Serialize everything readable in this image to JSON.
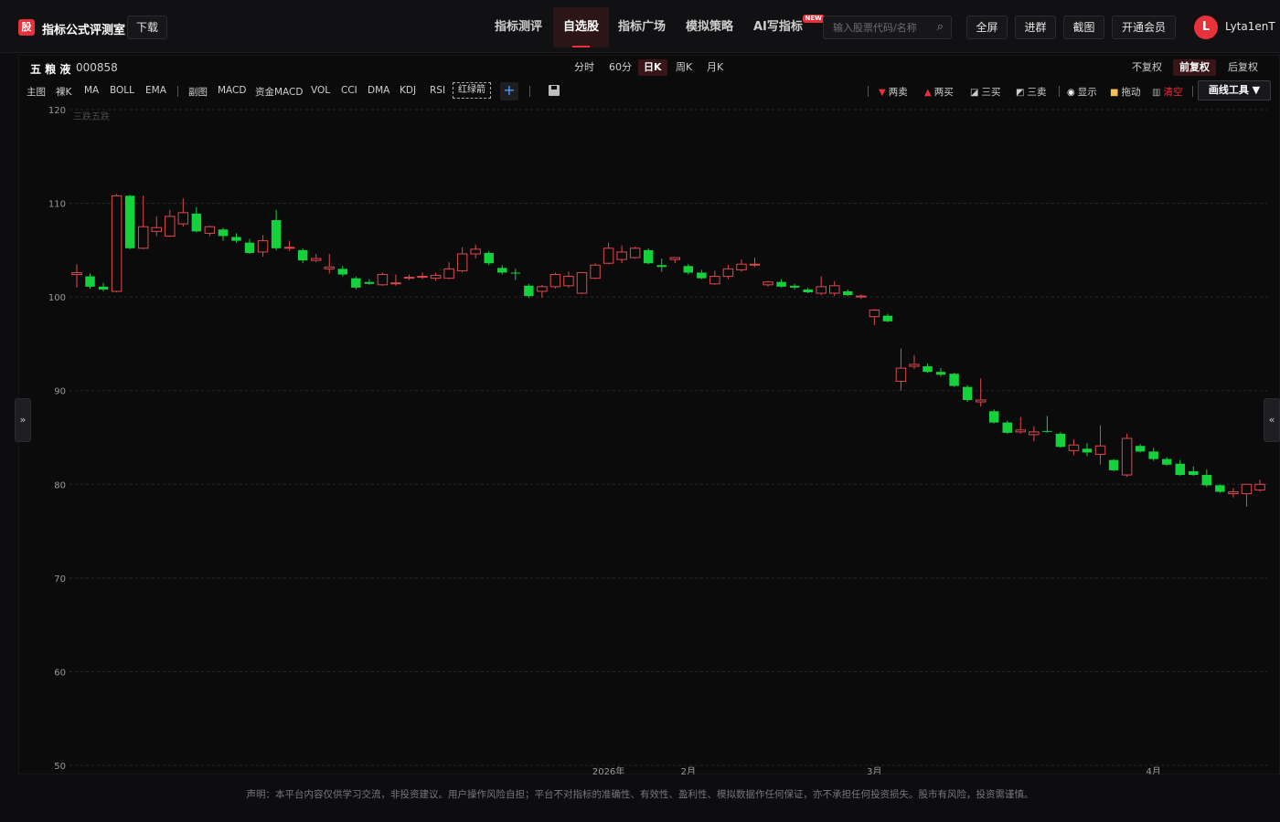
{
  "header": {
    "logo_char": "股",
    "app_title": "指标公式评测室",
    "download": "下载",
    "nav": [
      "指标测评",
      "自选股",
      "指标广场",
      "模拟策略",
      "AI写指标"
    ],
    "nav_active_index": 1,
    "new_badge": "NEW",
    "search_placeholder": "输入股票代码/名称",
    "fullscreen": "全屏",
    "join_group": "进群",
    "screenshot": "截图",
    "vip": "开通会员",
    "avatar_letter": "L",
    "username": "Lyta1enT"
  },
  "stock": {
    "name": "五 粮 液",
    "code": "000858"
  },
  "periods": [
    "分时",
    "60分",
    "日K",
    "周K",
    "月K"
  ],
  "period_active_index": 2,
  "adjust": [
    "不复权",
    "前复权",
    "后复权"
  ],
  "adjust_active_index": 1,
  "main_indicators": [
    "主图",
    "裸K",
    "MA",
    "BOLL",
    "EMA"
  ],
  "sub_indicators": [
    "副图",
    "MACD",
    "资金MACD",
    "VOL",
    "CCI",
    "DMA",
    "KDJ",
    "RSI"
  ],
  "red_green_arrow": "红绿箭",
  "draw_tools": {
    "two_sell": "两卖",
    "two_buy": "两买",
    "three_buy": "三买",
    "three_sell": "三卖",
    "show": "显示",
    "drag": "拖动",
    "clear": "清空",
    "tools_menu": "画线工具 ▼"
  },
  "side_left": "»",
  "side_right": "«",
  "chart_data": {
    "type": "candlestick",
    "annotation": "三跌五跌",
    "ylim": [
      50,
      120
    ],
    "yticks": [
      50,
      60,
      70,
      80,
      90,
      100,
      110,
      120
    ],
    "x_labels": [
      {
        "label": "2026年",
        "index": 40
      },
      {
        "label": "2月",
        "index": 46
      },
      {
        "label": "3月",
        "index": 60
      },
      {
        "label": "4月",
        "index": 81
      }
    ],
    "up_color": "#e0484c",
    "down_color": "#14d13c",
    "candles": [
      {
        "o": 102.4,
        "h": 103.5,
        "l": 101.0,
        "c": 102.6
      },
      {
        "o": 102.2,
        "h": 102.5,
        "l": 100.9,
        "c": 101.1
      },
      {
        "o": 101.1,
        "h": 101.5,
        "l": 100.6,
        "c": 100.8
      },
      {
        "o": 100.6,
        "h": 111.0,
        "l": 100.5,
        "c": 110.8
      },
      {
        "o": 110.8,
        "h": 110.9,
        "l": 105.1,
        "c": 105.2
      },
      {
        "o": 105.2,
        "h": 110.8,
        "l": 105.1,
        "c": 107.5
      },
      {
        "o": 107.0,
        "h": 108.6,
        "l": 106.5,
        "c": 107.4
      },
      {
        "o": 106.5,
        "h": 109.3,
        "l": 106.4,
        "c": 108.6
      },
      {
        "o": 107.8,
        "h": 110.5,
        "l": 107.5,
        "c": 109.0
      },
      {
        "o": 108.9,
        "h": 109.6,
        "l": 106.9,
        "c": 107.0
      },
      {
        "o": 106.8,
        "h": 107.6,
        "l": 106.5,
        "c": 107.5
      },
      {
        "o": 107.2,
        "h": 107.4,
        "l": 106.0,
        "c": 106.5
      },
      {
        "o": 106.4,
        "h": 106.8,
        "l": 105.8,
        "c": 106.0
      },
      {
        "o": 105.8,
        "h": 106.2,
        "l": 104.6,
        "c": 104.7
      },
      {
        "o": 104.8,
        "h": 106.6,
        "l": 104.3,
        "c": 106.0
      },
      {
        "o": 108.2,
        "h": 109.3,
        "l": 105.0,
        "c": 105.2
      },
      {
        "o": 105.2,
        "h": 106.0,
        "l": 104.9,
        "c": 105.3
      },
      {
        "o": 105.0,
        "h": 105.2,
        "l": 103.6,
        "c": 103.9
      },
      {
        "o": 103.9,
        "h": 104.6,
        "l": 103.7,
        "c": 104.1
      },
      {
        "o": 103.0,
        "h": 104.6,
        "l": 102.5,
        "c": 103.2
      },
      {
        "o": 103.0,
        "h": 103.3,
        "l": 102.2,
        "c": 102.4
      },
      {
        "o": 102.0,
        "h": 102.2,
        "l": 100.8,
        "c": 101.0
      },
      {
        "o": 101.6,
        "h": 101.9,
        "l": 101.3,
        "c": 101.4
      },
      {
        "o": 101.3,
        "h": 102.6,
        "l": 101.2,
        "c": 102.4
      },
      {
        "o": 101.4,
        "h": 102.4,
        "l": 101.2,
        "c": 101.5
      },
      {
        "o": 102.0,
        "h": 102.4,
        "l": 101.8,
        "c": 102.1
      },
      {
        "o": 102.1,
        "h": 102.6,
        "l": 101.9,
        "c": 102.2
      },
      {
        "o": 102.0,
        "h": 102.6,
        "l": 101.7,
        "c": 102.3
      },
      {
        "o": 102.0,
        "h": 103.7,
        "l": 101.9,
        "c": 103.0
      },
      {
        "o": 102.8,
        "h": 105.3,
        "l": 102.6,
        "c": 104.6
      },
      {
        "o": 104.6,
        "h": 105.6,
        "l": 104.1,
        "c": 105.1
      },
      {
        "o": 104.7,
        "h": 104.9,
        "l": 103.4,
        "c": 103.6
      },
      {
        "o": 103.1,
        "h": 103.4,
        "l": 102.4,
        "c": 102.6
      },
      {
        "o": 102.6,
        "h": 103.0,
        "l": 101.8,
        "c": 102.5
      },
      {
        "o": 101.2,
        "h": 101.4,
        "l": 99.9,
        "c": 100.1
      },
      {
        "o": 100.6,
        "h": 101.3,
        "l": 99.9,
        "c": 101.1
      },
      {
        "o": 101.1,
        "h": 102.6,
        "l": 100.9,
        "c": 102.4
      },
      {
        "o": 101.2,
        "h": 102.7,
        "l": 101.0,
        "c": 102.2
      },
      {
        "o": 100.4,
        "h": 102.4,
        "l": 100.3,
        "c": 102.6
      },
      {
        "o": 102.0,
        "h": 103.6,
        "l": 101.9,
        "c": 103.4
      },
      {
        "o": 103.6,
        "h": 105.8,
        "l": 103.5,
        "c": 105.2
      },
      {
        "o": 104.0,
        "h": 105.5,
        "l": 103.6,
        "c": 104.8
      },
      {
        "o": 104.2,
        "h": 105.4,
        "l": 104.1,
        "c": 105.2
      },
      {
        "o": 105.0,
        "h": 105.2,
        "l": 103.5,
        "c": 103.6
      },
      {
        "o": 103.4,
        "h": 104.1,
        "l": 102.7,
        "c": 103.2
      },
      {
        "o": 104.0,
        "h": 104.2,
        "l": 103.6,
        "c": 104.2
      },
      {
        "o": 103.3,
        "h": 103.5,
        "l": 102.4,
        "c": 102.6
      },
      {
        "o": 102.6,
        "h": 102.9,
        "l": 101.9,
        "c": 102.0
      },
      {
        "o": 101.4,
        "h": 102.8,
        "l": 101.3,
        "c": 102.2
      },
      {
        "o": 102.2,
        "h": 103.4,
        "l": 101.9,
        "c": 103.0
      },
      {
        "o": 102.9,
        "h": 104.0,
        "l": 102.7,
        "c": 103.5
      },
      {
        "o": 103.4,
        "h": 104.2,
        "l": 103.2,
        "c": 103.5
      },
      {
        "o": 101.3,
        "h": 101.7,
        "l": 101.1,
        "c": 101.6
      },
      {
        "o": 101.6,
        "h": 101.9,
        "l": 101.0,
        "c": 101.1
      },
      {
        "o": 101.2,
        "h": 101.4,
        "l": 100.8,
        "c": 101.0
      },
      {
        "o": 100.8,
        "h": 101.0,
        "l": 100.4,
        "c": 100.5
      },
      {
        "o": 100.4,
        "h": 102.2,
        "l": 100.2,
        "c": 101.1
      },
      {
        "o": 100.4,
        "h": 101.7,
        "l": 100.1,
        "c": 101.2
      },
      {
        "o": 100.6,
        "h": 100.8,
        "l": 100.1,
        "c": 100.2
      },
      {
        "o": 100.0,
        "h": 100.3,
        "l": 99.8,
        "c": 100.1
      },
      {
        "o": 97.9,
        "h": 98.7,
        "l": 97.0,
        "c": 98.6
      },
      {
        "o": 98.0,
        "h": 98.2,
        "l": 97.3,
        "c": 97.4
      },
      {
        "o": 91.0,
        "h": 94.5,
        "l": 90.0,
        "c": 92.4
      },
      {
        "o": 92.6,
        "h": 93.8,
        "l": 92.3,
        "c": 92.8
      },
      {
        "o": 92.6,
        "h": 92.9,
        "l": 91.9,
        "c": 92.0
      },
      {
        "o": 92.0,
        "h": 92.4,
        "l": 91.5,
        "c": 91.7
      },
      {
        "o": 91.8,
        "h": 91.9,
        "l": 90.4,
        "c": 90.5
      },
      {
        "o": 90.4,
        "h": 90.6,
        "l": 88.8,
        "c": 89.0
      },
      {
        "o": 88.8,
        "h": 91.3,
        "l": 88.3,
        "c": 89.0
      },
      {
        "o": 87.8,
        "h": 88.0,
        "l": 86.5,
        "c": 86.6
      },
      {
        "o": 86.6,
        "h": 86.8,
        "l": 85.4,
        "c": 85.5
      },
      {
        "o": 85.6,
        "h": 87.2,
        "l": 85.4,
        "c": 85.8
      },
      {
        "o": 85.3,
        "h": 86.2,
        "l": 84.6,
        "c": 85.6
      },
      {
        "o": 85.7,
        "h": 87.3,
        "l": 85.5,
        "c": 85.6
      },
      {
        "o": 85.4,
        "h": 85.6,
        "l": 83.9,
        "c": 84.0
      },
      {
        "o": 83.6,
        "h": 84.8,
        "l": 83.1,
        "c": 84.2
      },
      {
        "o": 83.8,
        "h": 84.4,
        "l": 83.0,
        "c": 83.4
      },
      {
        "o": 83.2,
        "h": 86.3,
        "l": 82.1,
        "c": 84.1
      },
      {
        "o": 82.6,
        "h": 82.7,
        "l": 81.4,
        "c": 81.5
      },
      {
        "o": 81.0,
        "h": 85.4,
        "l": 80.8,
        "c": 84.9
      },
      {
        "o": 84.1,
        "h": 84.3,
        "l": 83.4,
        "c": 83.5
      },
      {
        "o": 83.5,
        "h": 83.9,
        "l": 82.5,
        "c": 82.7
      },
      {
        "o": 82.7,
        "h": 82.9,
        "l": 82.0,
        "c": 82.1
      },
      {
        "o": 82.2,
        "h": 82.6,
        "l": 80.9,
        "c": 81.0
      },
      {
        "o": 81.4,
        "h": 81.9,
        "l": 80.9,
        "c": 81.0
      },
      {
        "o": 81.0,
        "h": 81.6,
        "l": 79.7,
        "c": 79.9
      },
      {
        "o": 79.9,
        "h": 80.0,
        "l": 79.1,
        "c": 79.2
      },
      {
        "o": 79.0,
        "h": 79.6,
        "l": 78.6,
        "c": 79.2
      },
      {
        "o": 79.0,
        "h": 80.0,
        "l": 77.6,
        "c": 80.0
      },
      {
        "o": 79.4,
        "h": 80.5,
        "l": 79.2,
        "c": 80.0
      }
    ]
  },
  "footer": "声明：本平台内容仅供学习交流，非投资建议。用户操作风险自担；平台不对指标的准确性、有效性、盈利性、模拟数据作任何保证，亦不承担任何投资损失。股市有风险，投资需谨慎。"
}
